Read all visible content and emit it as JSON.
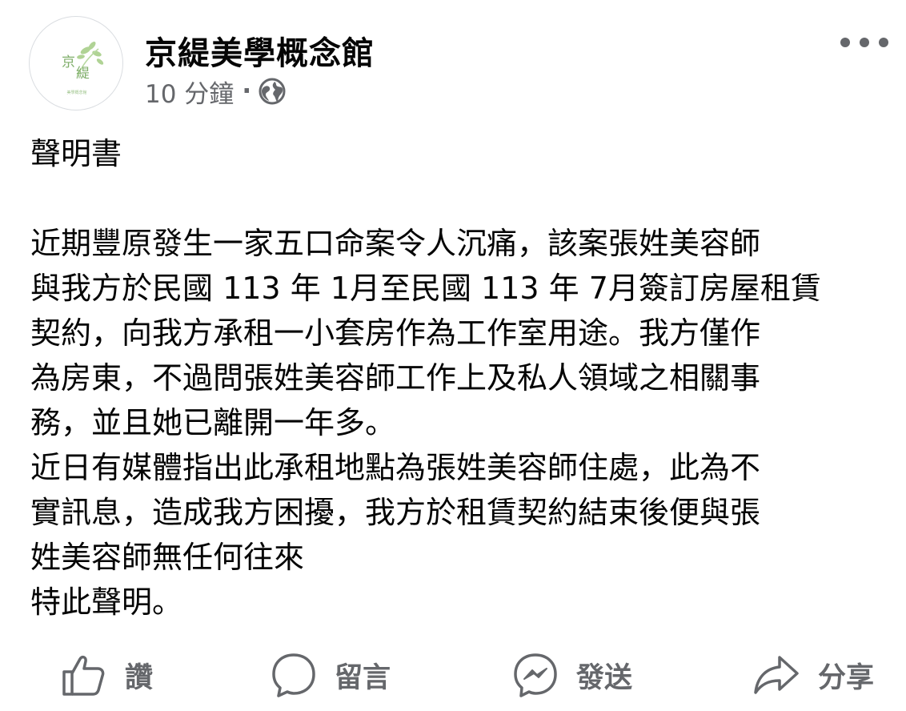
{
  "post": {
    "page_name": "京緹美學概念館",
    "avatar": {
      "text_top": "京",
      "text_bottom": "緹",
      "text_caption": "美學概念館"
    },
    "timestamp": "10 分鐘",
    "separator": "·",
    "privacy_icon": "globe-icon",
    "more_icon": "more-options-icon",
    "body": {
      "title": "聲明書",
      "lines": [
        "近期豐原發生一家五口命案令人沉痛，該案張姓美容師",
        "與我方於民國 113 年 1月至民國 113 年 7月簽訂房屋租賃",
        "契約，向我方承租一小套房作為工作室用途。我方僅作",
        "為房東，不過問張姓美容師工作上及私人領域之相關事",
        "務，並且她已離開一年多。",
        "近日有媒體指出此承租地點為張姓美容師住處，此為不",
        "實訊息，造成我方困擾，我方於租賃契約結束後便與張",
        "姓美容師無任何往來",
        "特此聲明。"
      ]
    }
  },
  "actions": {
    "like": {
      "label": "讚",
      "icon": "thumbs-up-icon"
    },
    "comment": {
      "label": "留言",
      "icon": "comment-bubble-icon"
    },
    "send": {
      "label": "發送",
      "icon": "messenger-icon"
    },
    "share": {
      "label": "分享",
      "icon": "share-arrow-icon"
    }
  },
  "colors": {
    "primary_text": "#050505",
    "secondary_text": "#65676b",
    "avatar_green": "#8fb97a"
  }
}
